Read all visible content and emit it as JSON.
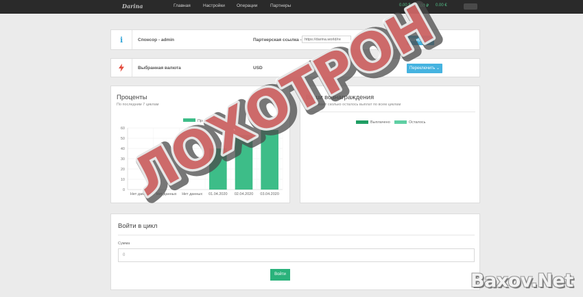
{
  "app": {
    "logo": "Darina"
  },
  "nav": {
    "items": [
      "Главная",
      "Настройки",
      "Операции",
      "Партнеры"
    ]
  },
  "balances": [
    "0.00 $",
    "0.00 ₽",
    "0.00 €"
  ],
  "sponsor": {
    "label": "Спонсор - admin",
    "ref_label": "Партнерская ссылка -",
    "ref_value": "https://darina.world/re",
    "copy_button": "Копировать"
  },
  "currency": {
    "label": "Выбранная валюта",
    "value": "USD",
    "switch_button": "Переключить"
  },
  "percent_panel": {
    "title": "Проценты",
    "subtitle": "По последним 7 циклам"
  },
  "rewards_panel": {
    "title": "Ваши вознаграждения",
    "subtitle": "Показывает сколько осталось выплат по всем циклам",
    "legend": [
      "Выплачено",
      "Осталось"
    ]
  },
  "chart_data": {
    "type": "bar",
    "categories": [
      "Нет данных",
      "Нет данных",
      "Нет данных",
      "01.04.2020",
      "02.04.2020",
      "03.04.2020"
    ],
    "series": [
      {
        "name": "Проценты",
        "values": [
          0,
          0,
          0,
          40,
          53,
          58
        ]
      }
    ],
    "ylim": [
      0,
      60
    ],
    "yticks": [
      0,
      10,
      20,
      30,
      40,
      50,
      60
    ],
    "colors": {
      "bar": "#3dbd88"
    }
  },
  "join_panel": {
    "title": "Войти в цикл",
    "amount_label": "Сумма",
    "amount_value": "0",
    "submit_button": "Войти"
  },
  "overlay": {
    "stamp_text": "ЛОХОТРОН",
    "watermark": "Baxov.Net"
  }
}
